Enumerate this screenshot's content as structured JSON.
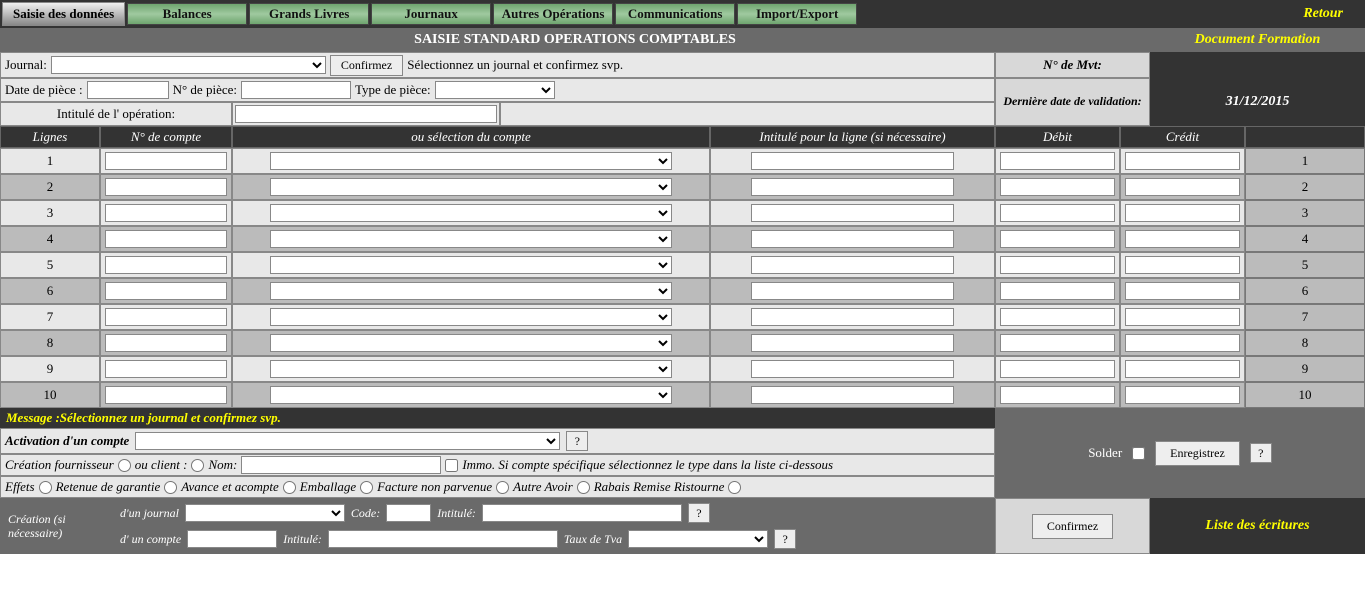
{
  "tabs": {
    "active": "Saisie des données",
    "items": [
      "Balances",
      "Grands Livres",
      "Journaux",
      "Autres Opérations",
      "Communications",
      "Import/Export"
    ],
    "retour": "Retour"
  },
  "title": {
    "main": "SAISIE STANDARD OPERATIONS COMPTABLES",
    "right": "Document Formation"
  },
  "journal": {
    "label": "Journal:",
    "confirm": "Confirmez",
    "hint": "Sélectionnez un journal et confirmez svp.",
    "nmvt_label": "N° de Mvt:",
    "date_piece_label": "Date de pièce :",
    "n_piece_label": "N° de pièce:",
    "type_piece_label": "Type de pièce:",
    "intitule_label": "Intitulé de l' opération:",
    "dv_label": "Dernière date de validation:",
    "dv_value": "31/12/2015"
  },
  "grid": {
    "headers": {
      "lignes": "Lignes",
      "ncompte": "N° de compte",
      "sel": "ou sélection du compte",
      "intitule": "Intitulé pour la ligne (si nécessaire)",
      "debit": "Débit",
      "credit": "Crédit"
    },
    "rows": [
      1,
      2,
      3,
      4,
      5,
      6,
      7,
      8,
      9,
      10
    ]
  },
  "message": {
    "prefix": "Message : ",
    "text": "Sélectionnez un journal et confirmez svp."
  },
  "activation": {
    "label": "Activation d'un compte",
    "q": "?"
  },
  "creation": {
    "line1_prefix": "Création fournisseur",
    "ou_client": "ou client :",
    "nom": "Nom:",
    "immo": "Immo. Si compte spécifique sélectionnez le type dans la liste ci-dessous",
    "effets": "Effets",
    "retenue": "Retenue de garantie",
    "avance": "Avance et acompte",
    "emballage": "Emballage",
    "facture": "Facture non parvenue",
    "autre": "Autre Avoir",
    "rabais": "Rabais Remise Ristourne"
  },
  "solder": {
    "label": "Solder",
    "enregistrer": "Enregistrez",
    "q": "?"
  },
  "bottom": {
    "cre_label": "Création (si nécessaire)",
    "journal": "d'un journal",
    "code": "Code:",
    "intitule": "Intitulé:",
    "q": "?",
    "compte": "d' un compte",
    "intitule2": "Intitulé:",
    "taux": "Taux de Tva",
    "confirm": "Confirmez",
    "liste": "Liste des écritures"
  }
}
